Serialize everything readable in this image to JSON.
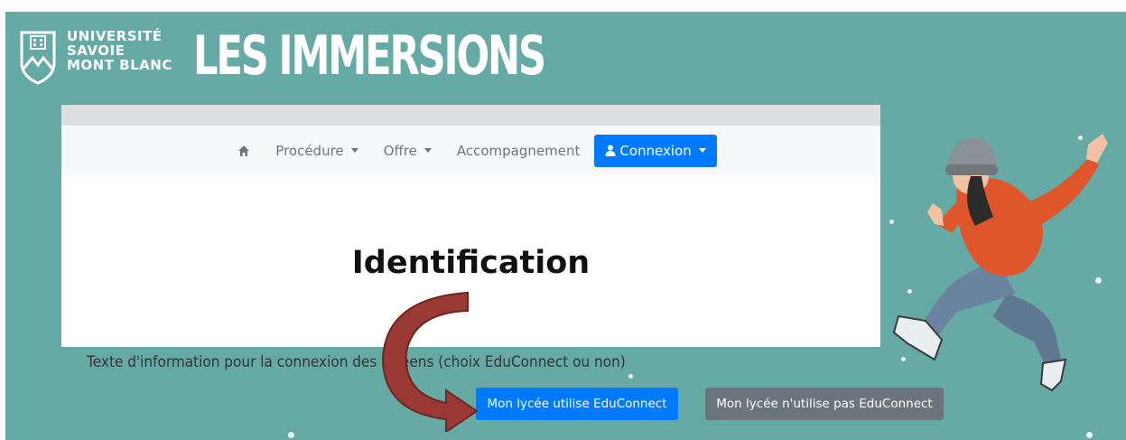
{
  "header": {
    "university_logo": {
      "lines": [
        "UNIVERSITÉ",
        "SAVOIE",
        "MONT BLANC"
      ],
      "icon": "shield-logo-icon"
    },
    "site_title": "LES IMMERSIONS"
  },
  "navbar": {
    "home_icon": "home-icon",
    "items": [
      {
        "label": "Procédure",
        "has_dropdown": true
      },
      {
        "label": "Offre",
        "has_dropdown": true
      },
      {
        "label": "Accompagnement",
        "has_dropdown": false
      }
    ],
    "connexion": {
      "label": "Connexion",
      "icon": "user-icon",
      "has_dropdown": true
    }
  },
  "main": {
    "title": "Identification",
    "info_text": "Texte d'information pour la connexion des lycéens (choix EduConnect ou non)",
    "buttons": {
      "educonnect": "Mon lycée utilise EduConnect",
      "no_educonnect": "Mon lycée n'utilise pas EduConnect"
    }
  },
  "colors": {
    "background": "#66aaa6",
    "primary": "#007bff",
    "secondary": "#6c757d",
    "annotation_arrow": "#9b3a35"
  }
}
